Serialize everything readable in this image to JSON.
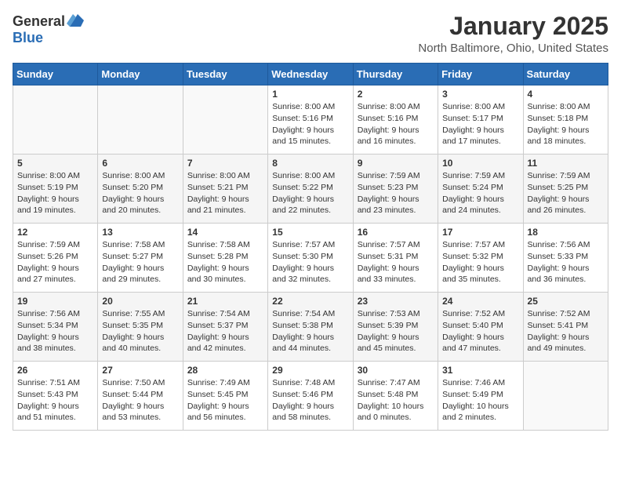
{
  "header": {
    "logo_general": "General",
    "logo_blue": "Blue",
    "month": "January 2025",
    "location": "North Baltimore, Ohio, United States"
  },
  "weekdays": [
    "Sunday",
    "Monday",
    "Tuesday",
    "Wednesday",
    "Thursday",
    "Friday",
    "Saturday"
  ],
  "weeks": [
    [
      {
        "day": "",
        "info": ""
      },
      {
        "day": "",
        "info": ""
      },
      {
        "day": "",
        "info": ""
      },
      {
        "day": "1",
        "info": "Sunrise: 8:00 AM\nSunset: 5:16 PM\nDaylight: 9 hours\nand 15 minutes."
      },
      {
        "day": "2",
        "info": "Sunrise: 8:00 AM\nSunset: 5:16 PM\nDaylight: 9 hours\nand 16 minutes."
      },
      {
        "day": "3",
        "info": "Sunrise: 8:00 AM\nSunset: 5:17 PM\nDaylight: 9 hours\nand 17 minutes."
      },
      {
        "day": "4",
        "info": "Sunrise: 8:00 AM\nSunset: 5:18 PM\nDaylight: 9 hours\nand 18 minutes."
      }
    ],
    [
      {
        "day": "5",
        "info": "Sunrise: 8:00 AM\nSunset: 5:19 PM\nDaylight: 9 hours\nand 19 minutes."
      },
      {
        "day": "6",
        "info": "Sunrise: 8:00 AM\nSunset: 5:20 PM\nDaylight: 9 hours\nand 20 minutes."
      },
      {
        "day": "7",
        "info": "Sunrise: 8:00 AM\nSunset: 5:21 PM\nDaylight: 9 hours\nand 21 minutes."
      },
      {
        "day": "8",
        "info": "Sunrise: 8:00 AM\nSunset: 5:22 PM\nDaylight: 9 hours\nand 22 minutes."
      },
      {
        "day": "9",
        "info": "Sunrise: 7:59 AM\nSunset: 5:23 PM\nDaylight: 9 hours\nand 23 minutes."
      },
      {
        "day": "10",
        "info": "Sunrise: 7:59 AM\nSunset: 5:24 PM\nDaylight: 9 hours\nand 24 minutes."
      },
      {
        "day": "11",
        "info": "Sunrise: 7:59 AM\nSunset: 5:25 PM\nDaylight: 9 hours\nand 26 minutes."
      }
    ],
    [
      {
        "day": "12",
        "info": "Sunrise: 7:59 AM\nSunset: 5:26 PM\nDaylight: 9 hours\nand 27 minutes."
      },
      {
        "day": "13",
        "info": "Sunrise: 7:58 AM\nSunset: 5:27 PM\nDaylight: 9 hours\nand 29 minutes."
      },
      {
        "day": "14",
        "info": "Sunrise: 7:58 AM\nSunset: 5:28 PM\nDaylight: 9 hours\nand 30 minutes."
      },
      {
        "day": "15",
        "info": "Sunrise: 7:57 AM\nSunset: 5:30 PM\nDaylight: 9 hours\nand 32 minutes."
      },
      {
        "day": "16",
        "info": "Sunrise: 7:57 AM\nSunset: 5:31 PM\nDaylight: 9 hours\nand 33 minutes."
      },
      {
        "day": "17",
        "info": "Sunrise: 7:57 AM\nSunset: 5:32 PM\nDaylight: 9 hours\nand 35 minutes."
      },
      {
        "day": "18",
        "info": "Sunrise: 7:56 AM\nSunset: 5:33 PM\nDaylight: 9 hours\nand 36 minutes."
      }
    ],
    [
      {
        "day": "19",
        "info": "Sunrise: 7:56 AM\nSunset: 5:34 PM\nDaylight: 9 hours\nand 38 minutes."
      },
      {
        "day": "20",
        "info": "Sunrise: 7:55 AM\nSunset: 5:35 PM\nDaylight: 9 hours\nand 40 minutes."
      },
      {
        "day": "21",
        "info": "Sunrise: 7:54 AM\nSunset: 5:37 PM\nDaylight: 9 hours\nand 42 minutes."
      },
      {
        "day": "22",
        "info": "Sunrise: 7:54 AM\nSunset: 5:38 PM\nDaylight: 9 hours\nand 44 minutes."
      },
      {
        "day": "23",
        "info": "Sunrise: 7:53 AM\nSunset: 5:39 PM\nDaylight: 9 hours\nand 45 minutes."
      },
      {
        "day": "24",
        "info": "Sunrise: 7:52 AM\nSunset: 5:40 PM\nDaylight: 9 hours\nand 47 minutes."
      },
      {
        "day": "25",
        "info": "Sunrise: 7:52 AM\nSunset: 5:41 PM\nDaylight: 9 hours\nand 49 minutes."
      }
    ],
    [
      {
        "day": "26",
        "info": "Sunrise: 7:51 AM\nSunset: 5:43 PM\nDaylight: 9 hours\nand 51 minutes."
      },
      {
        "day": "27",
        "info": "Sunrise: 7:50 AM\nSunset: 5:44 PM\nDaylight: 9 hours\nand 53 minutes."
      },
      {
        "day": "28",
        "info": "Sunrise: 7:49 AM\nSunset: 5:45 PM\nDaylight: 9 hours\nand 56 minutes."
      },
      {
        "day": "29",
        "info": "Sunrise: 7:48 AM\nSunset: 5:46 PM\nDaylight: 9 hours\nand 58 minutes."
      },
      {
        "day": "30",
        "info": "Sunrise: 7:47 AM\nSunset: 5:48 PM\nDaylight: 10 hours\nand 0 minutes."
      },
      {
        "day": "31",
        "info": "Sunrise: 7:46 AM\nSunset: 5:49 PM\nDaylight: 10 hours\nand 2 minutes."
      },
      {
        "day": "",
        "info": ""
      }
    ]
  ]
}
